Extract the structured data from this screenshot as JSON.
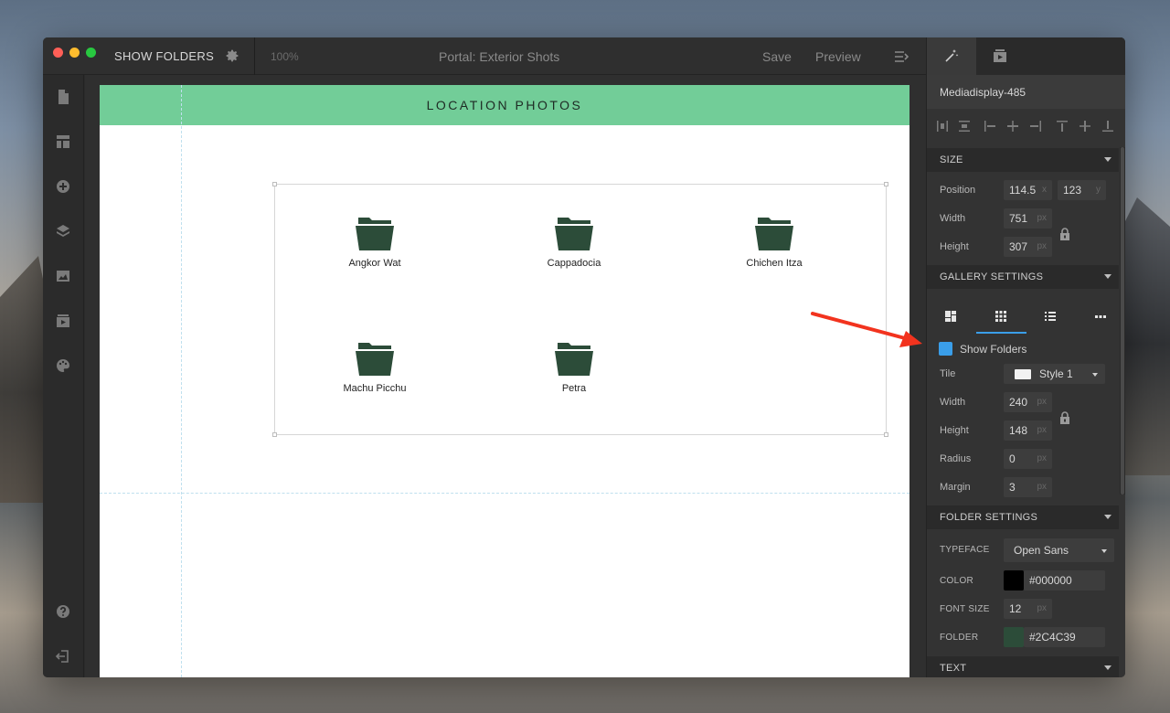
{
  "window": {
    "app_title": "SHOW FOLDERS",
    "zoom": "100%",
    "doc_title": "Portal: Exterior Shots",
    "save_label": "Save",
    "preview_label": "Preview"
  },
  "canvas": {
    "banner_title": "LOCATION PHOTOS",
    "folders": [
      {
        "label": "Angkor Wat"
      },
      {
        "label": "Cappadocia"
      },
      {
        "label": "Chichen Itza"
      },
      {
        "label": "Machu Picchu"
      },
      {
        "label": "Petra"
      }
    ],
    "folder_color": "#2C4C39",
    "banner_color": "#72CD98"
  },
  "panel": {
    "element_name": "Mediadisplay-485",
    "size": {
      "header": "SIZE",
      "position_label": "Position",
      "position_x": "114.5",
      "position_x_unit": "x",
      "position_y": "123",
      "position_y_unit": "y",
      "width_label": "Width",
      "width": "751",
      "height_label": "Height",
      "height": "307",
      "unit": "px"
    },
    "gallery": {
      "header": "GALLERY SETTINGS",
      "show_folders_label": "Show Folders",
      "show_folders_checked": true,
      "checkbox_color": "#3A9EE9",
      "tile_label": "Tile",
      "tile_value": "Style 1",
      "width_label": "Width",
      "width": "240",
      "height_label": "Height",
      "height": "148",
      "radius_label": "Radius",
      "radius": "0",
      "margin_label": "Margin",
      "margin": "3",
      "unit": "px"
    },
    "folder_settings": {
      "header": "FOLDER SETTINGS",
      "typeface_label": "TYPEFACE",
      "typeface": "Open Sans",
      "color_label": "COLOR",
      "color": "#000000",
      "font_size_label": "FONT SIZE",
      "font_size": "12",
      "unit": "px",
      "folder_label": "FOLDER",
      "folder_color": "#2C4C39"
    },
    "text_header": "TEXT"
  },
  "annotation": {
    "arrow_color": "#F2331E"
  }
}
